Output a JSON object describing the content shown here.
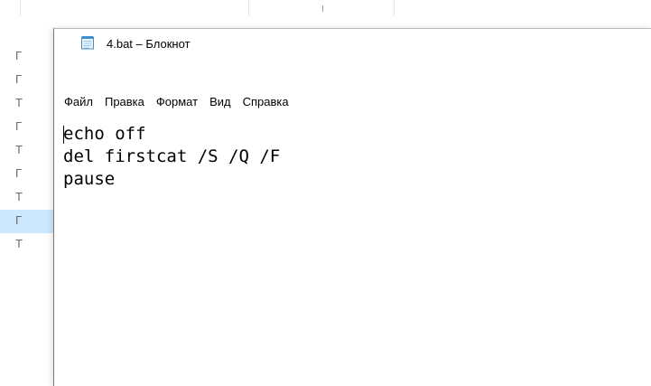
{
  "background_explorer": {
    "row_prefixes": [
      "Г",
      "Г",
      "Т",
      "Г",
      "Т",
      "Г",
      "Т",
      "Г",
      "Т"
    ],
    "selected_row_index": 7,
    "selection_color": "#cce8ff"
  },
  "notepad": {
    "title": "4.bat – Блокнот",
    "icon": "notepad-icon",
    "menu": [
      {
        "label": "Файл"
      },
      {
        "label": "Правка"
      },
      {
        "label": "Формат"
      },
      {
        "label": "Вид"
      },
      {
        "label": "Справка"
      }
    ],
    "content_lines": [
      "echo off",
      "del firstcat /S /Q /F",
      "pause"
    ]
  }
}
